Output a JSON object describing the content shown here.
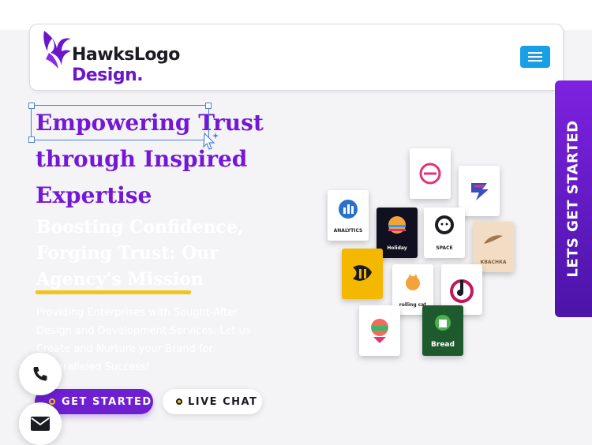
{
  "brand": {
    "name_line1": "HawksLogo",
    "name_line2": "Design.",
    "primary_color": "#7418d6",
    "accent_color": "#f3c518",
    "menu_button_color": "#18a0e6"
  },
  "nav": {
    "menu_icon": "hamburger-icon"
  },
  "hero": {
    "headline_lines": [
      "Empowering Trust",
      "through Inspired",
      "Expertise"
    ],
    "subheading_lines": [
      "Boosting Confidence,",
      "Forging Trust: Our",
      "Agency's Mission"
    ],
    "description_lines": [
      "Providing Enterprises with Sought-After",
      "Design and Development Services. Let us",
      "Create and Nurture your Brand for",
      "Unparalleled Success!"
    ],
    "cta_primary": "GET STARTED",
    "cta_secondary": "LIVE CHAT"
  },
  "floating": {
    "phone_icon": "phone-icon",
    "mail_icon": "mail-icon"
  },
  "side_tab": {
    "label": "LETS GET STARTED"
  },
  "portfolio_tiles": [
    {
      "label": ""
    },
    {
      "label": ""
    },
    {
      "label": "ANALYTICS"
    },
    {
      "label": "Holiday"
    },
    {
      "label": "SPACE"
    },
    {
      "label": "КВАСНКА"
    },
    {
      "label": ""
    },
    {
      "label": "rolling cat"
    },
    {
      "label": ""
    },
    {
      "label": ""
    },
    {
      "label": "Bread"
    }
  ]
}
